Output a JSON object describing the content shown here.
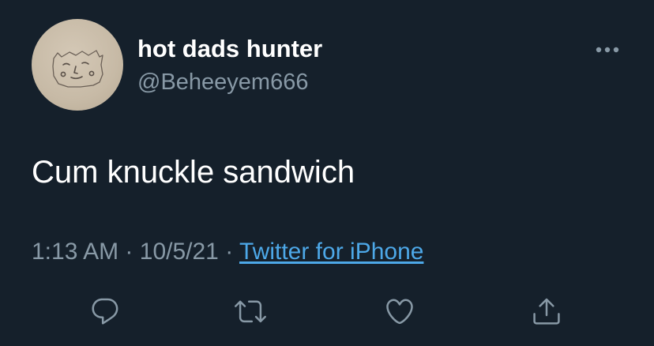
{
  "user": {
    "display_name": "hot dads hunter",
    "handle": "@Beheeyem666",
    "avatar_icon": "doodle-face-avatar"
  },
  "tweet": {
    "text": "Cum knuckle sandwich",
    "time": "1:13 AM",
    "separator": "·",
    "date": "10/5/21",
    "source": "Twitter for iPhone"
  },
  "actions": {
    "reply_icon": "reply-icon",
    "retweet_icon": "retweet-icon",
    "like_icon": "heart-icon",
    "share_icon": "share-icon",
    "more_icon": "more-options-icon"
  },
  "colors": {
    "background": "#15202b",
    "primary_text": "#ffffff",
    "secondary_text": "#8899a6",
    "link": "#4da8e8"
  }
}
